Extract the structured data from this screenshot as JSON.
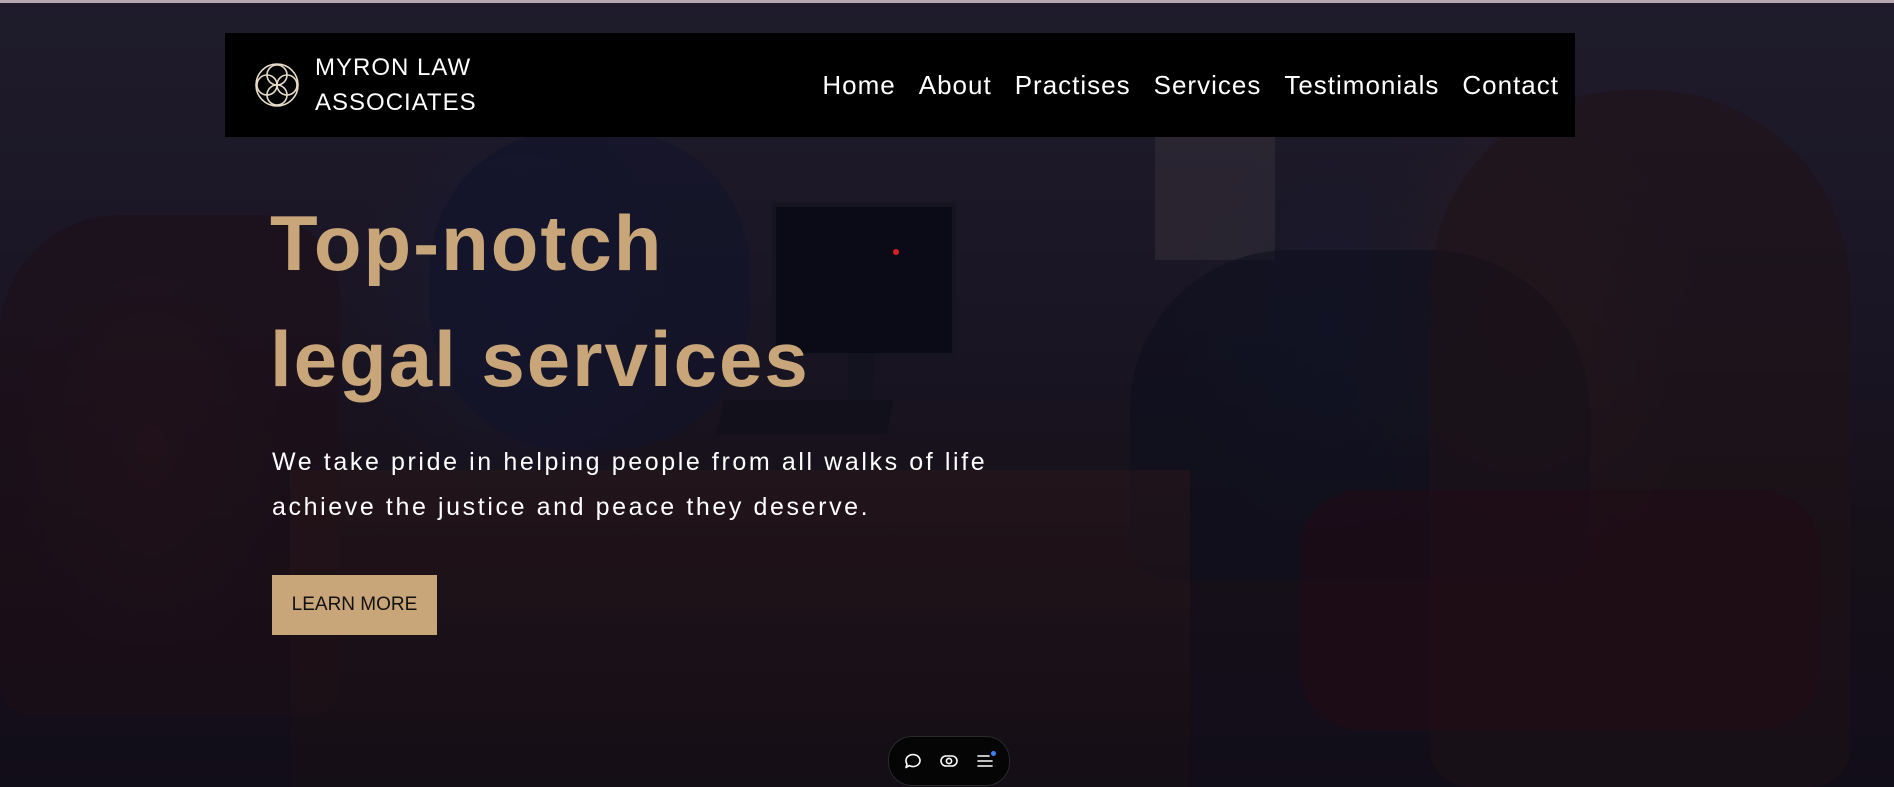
{
  "brand": {
    "name_line1": "MYRON LAW",
    "name_line2": "ASSOCIATES",
    "logo_icon": "interlocking-circles-icon"
  },
  "nav": {
    "items": [
      {
        "label": "Home"
      },
      {
        "label": "About"
      },
      {
        "label": "Practises"
      },
      {
        "label": "Services"
      },
      {
        "label": "Testimonials"
      },
      {
        "label": "Contact"
      }
    ]
  },
  "hero": {
    "headline_line1": "Top-notch",
    "headline_line2": "legal services",
    "subtext": "We take pride in helping people from all walks of life achieve the justice and peace they deserve.",
    "cta_label": "LEARN MORE"
  },
  "toolbar": {
    "icons": [
      "chat-bubble-icon",
      "toggle-eye-icon",
      "menu-list-icon"
    ]
  },
  "colors": {
    "accent": "#c9a679",
    "navbar_bg": "#000000",
    "text_light": "#ffffff",
    "notification_dot": "#3b82f6"
  }
}
